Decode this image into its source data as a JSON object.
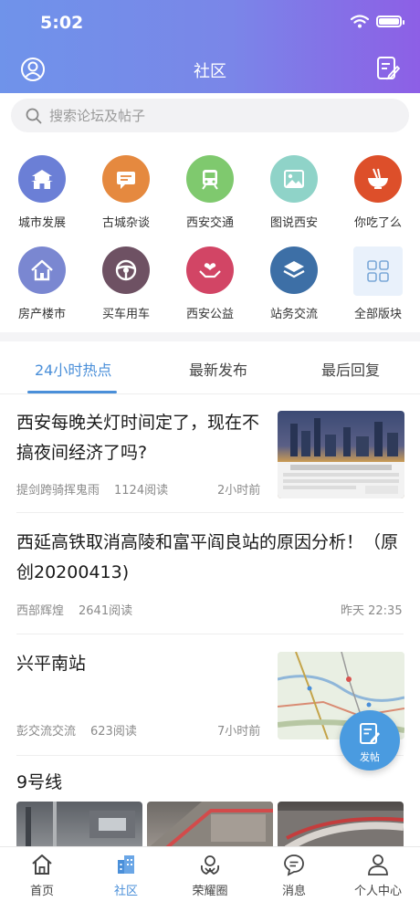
{
  "status_bar": {
    "time": "5:02"
  },
  "nav": {
    "title": "社区"
  },
  "search": {
    "placeholder": "搜索论坛及帖子"
  },
  "categories": [
    {
      "label": "城市发展",
      "icon": "city-gate-icon",
      "color": "#6b7fd6"
    },
    {
      "label": "古城杂谈",
      "icon": "chat-bubble-icon",
      "color": "#e5893f"
    },
    {
      "label": "西安交通",
      "icon": "train-icon",
      "color": "#7fc96e"
    },
    {
      "label": "图说西安",
      "icon": "picture-icon",
      "color": "#8fd3c8"
    },
    {
      "label": "你吃了么",
      "icon": "noodle-bowl-icon",
      "color": "#dd4f2a"
    },
    {
      "label": "房产楼市",
      "icon": "house-icon",
      "color": "#7a87d1"
    },
    {
      "label": "买车用车",
      "icon": "steering-wheel-icon",
      "color": "#6e5163"
    },
    {
      "label": "西安公益",
      "icon": "heart-hands-icon",
      "color": "#d24565"
    },
    {
      "label": "站务交流",
      "icon": "layers-icon",
      "color": "#3d6fa6"
    },
    {
      "label": "全部版块",
      "icon": "grid-icon",
      "color": "#e9f1fb"
    }
  ],
  "tabs": [
    {
      "label": "24小时热点"
    },
    {
      "label": "最新发布"
    },
    {
      "label": "最后回复"
    }
  ],
  "posts": [
    {
      "title": "西安每晚关灯时间定了，现在不搞夜间经济了吗?",
      "author": "提剑跨骑挥鬼雨",
      "reads": "1124阅读",
      "time": "2小时前"
    },
    {
      "title": "西延高铁取消高陵和富平阎良站的原因分析！（原创20200413)",
      "author": "西部辉煌",
      "reads": "2641阅读",
      "time": "昨天 22:35"
    },
    {
      "title": "兴平南站",
      "author": "彭交流交流",
      "reads": "623阅读",
      "time": "7小时前"
    },
    {
      "title": "9号线"
    }
  ],
  "fab": {
    "label": "发帖"
  },
  "tabbar": [
    {
      "label": "首页",
      "icon": "home-icon"
    },
    {
      "label": "社区",
      "icon": "community-icon"
    },
    {
      "label": "荣耀圈",
      "icon": "honor-icon"
    },
    {
      "label": "消息",
      "icon": "message-icon"
    },
    {
      "label": "个人中心",
      "icon": "person-icon"
    }
  ],
  "colors": {
    "accent": "#4a8fd9",
    "header_start": "#6f93ea",
    "header_end": "#8d5fe6"
  }
}
